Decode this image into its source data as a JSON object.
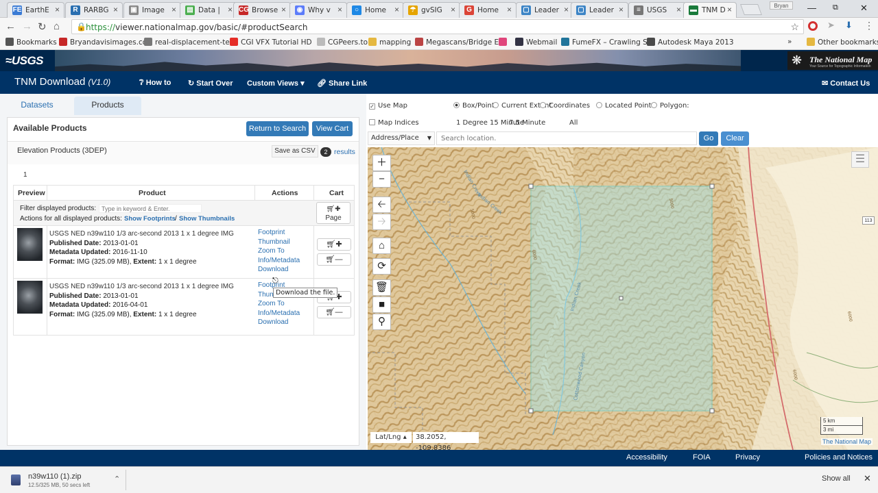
{
  "browser": {
    "tabs": [
      {
        "fav": "FE",
        "color": "#3a7bd5",
        "label": "EarthE"
      },
      {
        "fav": "R",
        "color": "#2a6fb0",
        "label": "RARBG"
      },
      {
        "fav": "▣",
        "color": "#888",
        "label": "Image"
      },
      {
        "fav": "▤",
        "color": "#4caf50",
        "label": "Data |"
      },
      {
        "fav": "CG",
        "color": "#c62828",
        "label": "Browse"
      },
      {
        "fav": "◉",
        "color": "#5c7cfa",
        "label": "Why v"
      },
      {
        "fav": "○",
        "color": "#1e88e5",
        "label": "Home"
      },
      {
        "fav": "☂",
        "color": "#e5a400",
        "label": "gvSIG"
      },
      {
        "fav": "G",
        "color": "#db4437",
        "label": "Home"
      },
      {
        "fav": "▢",
        "color": "#3d85c6",
        "label": "Leader"
      },
      {
        "fav": "▢",
        "color": "#3d85c6",
        "label": "Leader"
      },
      {
        "fav": "≡",
        "color": "#777",
        "label": "USGS"
      },
      {
        "fav": "▬",
        "color": "#1a7a3b",
        "label": "TNM D"
      }
    ],
    "user": "Bryan",
    "url_host": "https://",
    "url": "viewer.nationalmap.gov/basic/#productSearch",
    "bookmarks": [
      {
        "label": "Bookmarks",
        "icon": "star-icon",
        "color": "#555"
      },
      {
        "label": "Bryandavisimages.co",
        "icon": "gmail-icon",
        "color": "#c62828"
      },
      {
        "label": "real-displacement-te",
        "icon": "page-icon",
        "color": "#777"
      },
      {
        "label": "CGI VFX Tutorial HD",
        "icon": "youtube-icon",
        "color": "#e52d27"
      },
      {
        "label": "CGPeers.to",
        "icon": "page-icon",
        "color": "#bbb"
      },
      {
        "label": "mapping",
        "icon": "folder-icon",
        "color": "#e5b841"
      },
      {
        "label": "Megascans/Bridge Ex",
        "icon": "camera-icon",
        "color": "#b44"
      },
      {
        "label": "",
        "icon": "dribbble-icon",
        "color": "#e0457b"
      },
      {
        "label": "Webmail",
        "icon": "mail-icon",
        "color": "#334"
      },
      {
        "label": "FumeFX – Crawling St",
        "icon": "wordpress-icon",
        "color": "#21759b"
      },
      {
        "label": "Autodesk Maya 2013",
        "icon": "maya-icon",
        "color": "#4a4a4a"
      }
    ],
    "more": "»",
    "other_bookmarks": "Other bookmarks"
  },
  "usgs": {
    "logo": "≈USGS",
    "tnm_logo": "The National Map",
    "tnm_tagline": "Your Source for Topographic Information"
  },
  "nav": {
    "app_title": "TNM Download",
    "version": "(V1.0)",
    "how_to": "How to",
    "start_over": "Start Over",
    "custom_views": "Custom Views",
    "share_link": "Share Link",
    "contact_us": "Contact Us"
  },
  "left": {
    "tab_datasets": "Datasets",
    "tab_products": "Products",
    "available_products": "Available Products",
    "return_to_search": "Return to Search",
    "view_cart": "View Cart",
    "category": "Elevation Products (3DEP)",
    "save_csv": "Save as CSV",
    "results_count": "2",
    "results_label": "results",
    "page_number": "1",
    "col_preview": "Preview",
    "col_product": "Product",
    "col_actions": "Actions",
    "col_cart": "Cart",
    "filter_label": "Filter displayed products:",
    "filter_placeholder": "Type in keyword & Enter.",
    "actions_all_label": "Actions for all displayed products:",
    "show_footprints": "Show Footprints",
    "slash": "/",
    "show_thumbnails": "Show Thumbnails",
    "page_cart_label": "Page",
    "products": [
      {
        "title": "USGS NED n39w110 1/3 arc-second 2013 1 x 1 degree IMG",
        "published_label": "Published Date:",
        "published": "2013-01-01",
        "metadata_label": "Metadata Updated:",
        "metadata": "2016-11-10",
        "format_label": "Format:",
        "format": "IMG (325.09 MB),",
        "extent_label": "Extent:",
        "extent": "1 x 1 degree",
        "actions": [
          "Footprint",
          "Thumbnail",
          "Zoom To",
          "Info/Metadata",
          "Download"
        ]
      },
      {
        "title": "USGS NED n39w110 1/3 arc-second 2013 1 x 1 degree IMG",
        "published_label": "Published Date:",
        "published": "2013-01-01",
        "metadata_label": "Metadata Updated:",
        "metadata": "2016-04-01",
        "format_label": "Format:",
        "format": "IMG (325.09 MB),",
        "extent_label": "Extent:",
        "extent": "1 x 1 degree",
        "actions": [
          "Footprint",
          "Thumbnail",
          "Zoom To",
          "Info/Metadata",
          "Download"
        ]
      }
    ],
    "tooltip": "Download the file."
  },
  "map": {
    "use_map": "Use Map",
    "map_indices": "Map Indices",
    "modes": [
      "Box/Point",
      "Current Extent",
      "Coordinates",
      "Located Point",
      "Polygon:"
    ],
    "indices": [
      "1 Degree",
      "15 Minute",
      "7.5 Minute",
      "All"
    ],
    "search_type": "Address/Place",
    "search_placeholder": "Search location.",
    "go": "Go",
    "clear": "Clear",
    "latlng_label": "Lat/Lng ▴",
    "latlng": "38.2052, -109.8386",
    "scale_km": "5 km",
    "scale_mi": "3 mi",
    "attribution": "The National Map",
    "road_shield": "113",
    "labels": [
      "Indian Creek",
      "Indian Creek",
      "Cottonwood Canyon",
      "Indian Creek",
      "6000",
      "5000",
      "6000",
      "5000",
      "6000"
    ]
  },
  "footer": {
    "accessibility": "Accessibility",
    "foia": "FOIA",
    "privacy": "Privacy",
    "policies": "Policies and Notices"
  },
  "download": {
    "filename": "n39w110 (1).zip",
    "progress": "12.5/325 MB, 50 secs left",
    "show_all": "Show all"
  }
}
